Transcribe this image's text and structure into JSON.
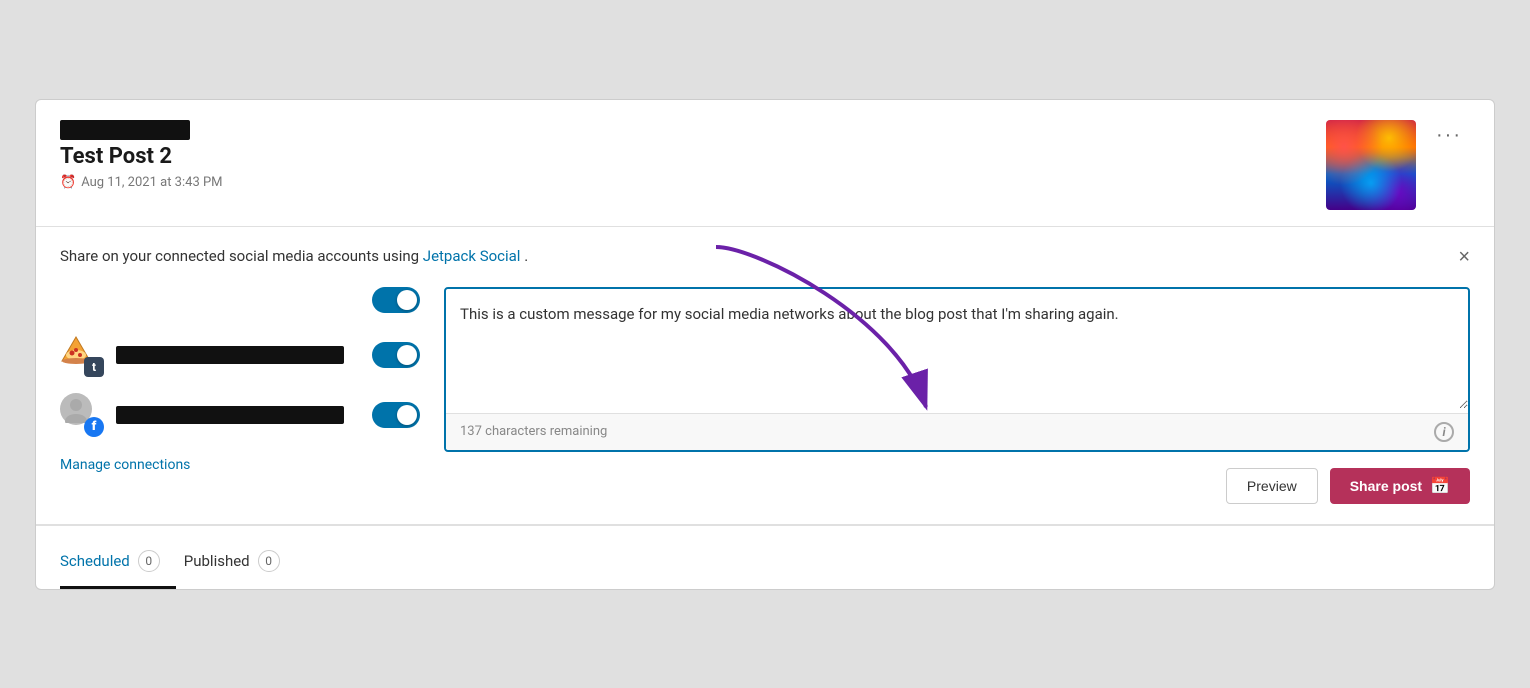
{
  "header": {
    "post_title": "Test Post 2",
    "post_date": "Aug 11, 2021 at 3:43 PM",
    "more_button_label": "···"
  },
  "share": {
    "description_prefix": "Share on your connected social media accounts using ",
    "link_text": "Jetpack Social",
    "description_suffix": ".",
    "close_label": "×",
    "message_text": "This is a custom message for my social media networks about the blog post that I'm sharing again.",
    "char_remaining": "137 characters remaining",
    "info_label": "i",
    "preview_label": "Preview",
    "share_post_label": "Share post"
  },
  "accounts": [
    {
      "type": "tumblr",
      "name_redacted": true
    },
    {
      "type": "facebook",
      "name_redacted": true
    }
  ],
  "manage_connections_label": "Manage connections",
  "tabs": [
    {
      "label": "Scheduled",
      "count": "0",
      "active": true
    },
    {
      "label": "Published",
      "count": "0",
      "active": false
    }
  ]
}
